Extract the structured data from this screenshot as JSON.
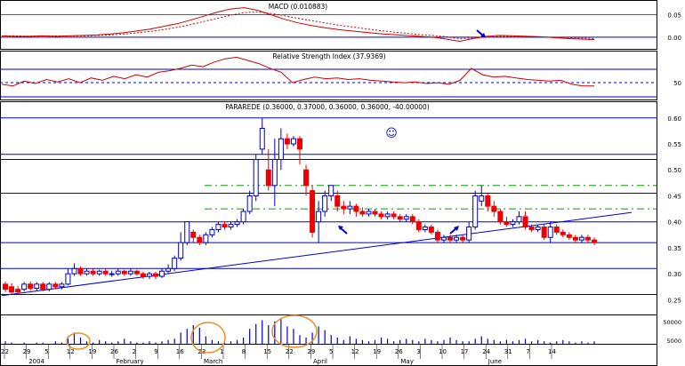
{
  "chart_data": [
    {
      "panel": "macd",
      "type": "line",
      "title": "MACD (0.010883)",
      "series": [
        {
          "values": [
            0.003,
            0.002,
            0.002,
            0.003,
            0.002,
            0.003,
            0.004,
            0.005,
            0.007,
            0.01,
            0.014,
            0.018,
            0.024,
            0.03,
            0.038,
            0.047,
            0.056,
            0.063,
            0.066,
            0.06,
            0.05,
            0.04,
            0.032,
            0.026,
            0.021,
            0.017,
            0.014,
            0.011,
            0.008,
            0.006,
            0.004,
            0.002,
            0.0,
            -0.004,
            -0.009,
            -0.003,
            0.002,
            0.004,
            0.003,
            0.002,
            0.001,
            -0.001,
            -0.003,
            -0.004,
            -0.005
          ]
        },
        {
          "values": [
            0.003,
            0.003,
            0.002,
            0.003,
            0.003,
            0.003,
            0.003,
            0.004,
            0.005,
            0.007,
            0.01,
            0.013,
            0.017,
            0.022,
            0.028,
            0.035,
            0.042,
            0.049,
            0.055,
            0.056,
            0.053,
            0.048,
            0.042,
            0.037,
            0.032,
            0.027,
            0.023,
            0.019,
            0.015,
            0.012,
            0.009,
            0.006,
            0.004,
            0.001,
            -0.003,
            -0.002,
            0.0,
            0.002,
            0.002,
            0.002,
            0.001,
            0.0,
            -0.001,
            -0.002,
            -0.003
          ]
        }
      ],
      "y_ticks": [
        "0.05",
        "0.00"
      ],
      "ylim": [
        -0.012,
        0.075
      ]
    },
    {
      "panel": "rsi",
      "type": "line",
      "title": "Relative Strength Index (37.9369)",
      "series": [
        {
          "values": [
            40,
            38,
            44,
            41,
            46,
            43,
            47,
            42,
            48,
            45,
            50,
            47,
            52,
            49,
            55,
            57,
            60,
            64,
            62,
            68,
            72,
            74,
            70,
            66,
            60,
            55,
            42,
            46,
            49,
            47,
            48,
            46,
            47,
            45,
            44,
            43,
            42,
            43,
            41,
            42,
            40,
            45,
            60,
            52,
            49,
            50,
            48,
            46,
            45,
            44,
            45,
            40,
            38,
            38
          ]
        }
      ],
      "y_ticks": [
        "50"
      ],
      "ylim": [
        22,
        80
      ]
    },
    {
      "panel": "price",
      "type": "candlestick",
      "title": "PARAREDE (0.36000, 0.37000, 0.36000, 0.36000, -40.00000)",
      "annotation": "☺",
      "y_ticks": [
        "0.60",
        "0.55",
        "0.50",
        "0.45",
        "0.40",
        "0.35",
        "0.30",
        "0.25"
      ],
      "ylim": [
        0.225,
        0.615
      ],
      "horizontal_lines": [
        0.6,
        0.53,
        0.52,
        0.455,
        0.4,
        0.36,
        0.31,
        0.26
      ],
      "dashed_lines": [
        0.47,
        0.425
      ],
      "trendline": [
        [
          0,
          0.258
        ],
        [
          96,
          0.418
        ]
      ],
      "candles": [
        {
          "o": 0.28,
          "c": 0.27,
          "h": 0.285,
          "l": 0.265,
          "d": "down"
        },
        {
          "o": 0.275,
          "c": 0.265,
          "h": 0.282,
          "l": 0.26,
          "d": "down"
        },
        {
          "o": 0.27,
          "c": 0.265,
          "h": 0.276,
          "l": 0.26,
          "d": "down"
        },
        {
          "o": 0.27,
          "c": 0.28,
          "h": 0.284,
          "l": 0.266,
          "d": "up"
        },
        {
          "o": 0.28,
          "c": 0.272,
          "h": 0.285,
          "l": 0.268,
          "d": "down"
        },
        {
          "o": 0.272,
          "c": 0.28,
          "h": 0.284,
          "l": 0.268,
          "d": "up"
        },
        {
          "o": 0.28,
          "c": 0.27,
          "h": 0.284,
          "l": 0.266,
          "d": "down"
        },
        {
          "o": 0.27,
          "c": 0.28,
          "h": 0.284,
          "l": 0.266,
          "d": "up"
        },
        {
          "o": 0.28,
          "c": 0.275,
          "h": 0.284,
          "l": 0.27,
          "d": "down"
        },
        {
          "o": 0.275,
          "c": 0.28,
          "h": 0.284,
          "l": 0.27,
          "d": "up"
        },
        {
          "o": 0.28,
          "c": 0.3,
          "h": 0.31,
          "l": 0.278,
          "d": "up"
        },
        {
          "o": 0.3,
          "c": 0.31,
          "h": 0.32,
          "l": 0.296,
          "d": "up"
        },
        {
          "o": 0.31,
          "c": 0.3,
          "h": 0.314,
          "l": 0.296,
          "d": "down"
        },
        {
          "o": 0.3,
          "c": 0.305,
          "h": 0.31,
          "l": 0.296,
          "d": "up"
        },
        {
          "o": 0.305,
          "c": 0.3,
          "h": 0.31,
          "l": 0.296,
          "d": "down"
        },
        {
          "o": 0.3,
          "c": 0.305,
          "h": 0.308,
          "l": 0.296,
          "d": "up"
        },
        {
          "o": 0.305,
          "c": 0.3,
          "h": 0.31,
          "l": 0.296,
          "d": "down"
        },
        {
          "o": 0.3,
          "c": 0.3,
          "h": 0.306,
          "l": 0.294,
          "d": "up"
        },
        {
          "o": 0.3,
          "c": 0.305,
          "h": 0.31,
          "l": 0.296,
          "d": "up"
        },
        {
          "o": 0.305,
          "c": 0.3,
          "h": 0.308,
          "l": 0.296,
          "d": "down"
        },
        {
          "o": 0.3,
          "c": 0.305,
          "h": 0.31,
          "l": 0.296,
          "d": "up"
        },
        {
          "o": 0.305,
          "c": 0.3,
          "h": 0.308,
          "l": 0.296,
          "d": "down"
        },
        {
          "o": 0.3,
          "c": 0.295,
          "h": 0.304,
          "l": 0.29,
          "d": "down"
        },
        {
          "o": 0.295,
          "c": 0.3,
          "h": 0.304,
          "l": 0.29,
          "d": "up"
        },
        {
          "o": 0.3,
          "c": 0.295,
          "h": 0.304,
          "l": 0.29,
          "d": "down"
        },
        {
          "o": 0.295,
          "c": 0.305,
          "h": 0.31,
          "l": 0.292,
          "d": "up"
        },
        {
          "o": 0.305,
          "c": 0.31,
          "h": 0.318,
          "l": 0.3,
          "d": "up"
        },
        {
          "o": 0.31,
          "c": 0.33,
          "h": 0.335,
          "l": 0.305,
          "d": "up"
        },
        {
          "o": 0.33,
          "c": 0.36,
          "h": 0.38,
          "l": 0.325,
          "d": "up"
        },
        {
          "o": 0.36,
          "c": 0.4,
          "h": 0.4,
          "l": 0.355,
          "d": "up"
        },
        {
          "o": 0.38,
          "c": 0.37,
          "h": 0.385,
          "l": 0.36,
          "d": "down"
        },
        {
          "o": 0.37,
          "c": 0.36,
          "h": 0.375,
          "l": 0.355,
          "d": "down"
        },
        {
          "o": 0.36,
          "c": 0.375,
          "h": 0.38,
          "l": 0.355,
          "d": "up"
        },
        {
          "o": 0.375,
          "c": 0.385,
          "h": 0.39,
          "l": 0.37,
          "d": "up"
        },
        {
          "o": 0.385,
          "c": 0.395,
          "h": 0.4,
          "l": 0.38,
          "d": "up"
        },
        {
          "o": 0.395,
          "c": 0.39,
          "h": 0.4,
          "l": 0.385,
          "d": "down"
        },
        {
          "o": 0.39,
          "c": 0.395,
          "h": 0.4,
          "l": 0.385,
          "d": "up"
        },
        {
          "o": 0.395,
          "c": 0.4,
          "h": 0.405,
          "l": 0.39,
          "d": "up"
        },
        {
          "o": 0.4,
          "c": 0.42,
          "h": 0.425,
          "l": 0.395,
          "d": "up"
        },
        {
          "o": 0.42,
          "c": 0.45,
          "h": 0.46,
          "l": 0.415,
          "d": "up"
        },
        {
          "o": 0.45,
          "c": 0.52,
          "h": 0.53,
          "l": 0.44,
          "d": "up"
        },
        {
          "o": 0.54,
          "c": 0.58,
          "h": 0.6,
          "l": 0.53,
          "d": "up"
        },
        {
          "o": 0.5,
          "c": 0.47,
          "h": 0.54,
          "l": 0.46,
          "d": "down"
        },
        {
          "o": 0.47,
          "c": 0.52,
          "h": 0.56,
          "l": 0.43,
          "d": "up"
        },
        {
          "o": 0.52,
          "c": 0.56,
          "h": 0.58,
          "l": 0.5,
          "d": "up"
        },
        {
          "o": 0.56,
          "c": 0.55,
          "h": 0.57,
          "l": 0.54,
          "d": "down"
        },
        {
          "o": 0.55,
          "c": 0.56,
          "h": 0.565,
          "l": 0.545,
          "d": "up"
        },
        {
          "o": 0.56,
          "c": 0.54,
          "h": 0.565,
          "l": 0.51,
          "d": "down"
        },
        {
          "o": 0.5,
          "c": 0.47,
          "h": 0.51,
          "l": 0.45,
          "d": "down"
        },
        {
          "o": 0.46,
          "c": 0.38,
          "h": 0.47,
          "l": 0.37,
          "d": "down"
        },
        {
          "o": 0.4,
          "c": 0.42,
          "h": 0.44,
          "l": 0.36,
          "d": "up"
        },
        {
          "o": 0.42,
          "c": 0.45,
          "h": 0.46,
          "l": 0.41,
          "d": "up"
        },
        {
          "o": 0.45,
          "c": 0.47,
          "h": 0.47,
          "l": 0.44,
          "d": "up"
        },
        {
          "o": 0.45,
          "c": 0.43,
          "h": 0.46,
          "l": 0.42,
          "d": "down"
        },
        {
          "o": 0.43,
          "c": 0.425,
          "h": 0.44,
          "l": 0.415,
          "d": "down"
        },
        {
          "o": 0.425,
          "c": 0.43,
          "h": 0.44,
          "l": 0.415,
          "d": "up"
        },
        {
          "o": 0.43,
          "c": 0.42,
          "h": 0.435,
          "l": 0.41,
          "d": "down"
        },
        {
          "o": 0.42,
          "c": 0.415,
          "h": 0.428,
          "l": 0.41,
          "d": "down"
        },
        {
          "o": 0.415,
          "c": 0.42,
          "h": 0.425,
          "l": 0.41,
          "d": "up"
        },
        {
          "o": 0.42,
          "c": 0.415,
          "h": 0.425,
          "l": 0.41,
          "d": "down"
        },
        {
          "o": 0.415,
          "c": 0.41,
          "h": 0.42,
          "l": 0.405,
          "d": "down"
        },
        {
          "o": 0.41,
          "c": 0.415,
          "h": 0.42,
          "l": 0.405,
          "d": "up"
        },
        {
          "o": 0.415,
          "c": 0.41,
          "h": 0.42,
          "l": 0.405,
          "d": "down"
        },
        {
          "o": 0.41,
          "c": 0.405,
          "h": 0.415,
          "l": 0.4,
          "d": "down"
        },
        {
          "o": 0.405,
          "c": 0.41,
          "h": 0.415,
          "l": 0.4,
          "d": "up"
        },
        {
          "o": 0.41,
          "c": 0.4,
          "h": 0.415,
          "l": 0.395,
          "d": "down"
        },
        {
          "o": 0.4,
          "c": 0.385,
          "h": 0.405,
          "l": 0.38,
          "d": "down"
        },
        {
          "o": 0.385,
          "c": 0.39,
          "h": 0.395,
          "l": 0.38,
          "d": "up"
        },
        {
          "o": 0.39,
          "c": 0.38,
          "h": 0.395,
          "l": 0.375,
          "d": "down"
        },
        {
          "o": 0.38,
          "c": 0.365,
          "h": 0.385,
          "l": 0.36,
          "d": "down"
        },
        {
          "o": 0.365,
          "c": 0.37,
          "h": 0.375,
          "l": 0.36,
          "d": "up"
        },
        {
          "o": 0.37,
          "c": 0.365,
          "h": 0.375,
          "l": 0.36,
          "d": "down"
        },
        {
          "o": 0.365,
          "c": 0.37,
          "h": 0.375,
          "l": 0.36,
          "d": "up"
        },
        {
          "o": 0.37,
          "c": 0.365,
          "h": 0.375,
          "l": 0.36,
          "d": "down"
        },
        {
          "o": 0.365,
          "c": 0.39,
          "h": 0.4,
          "l": 0.36,
          "d": "up"
        },
        {
          "o": 0.39,
          "c": 0.45,
          "h": 0.46,
          "l": 0.385,
          "d": "up"
        },
        {
          "o": 0.44,
          "c": 0.45,
          "h": 0.47,
          "l": 0.43,
          "d": "up"
        },
        {
          "o": 0.45,
          "c": 0.43,
          "h": 0.455,
          "l": 0.42,
          "d": "down"
        },
        {
          "o": 0.43,
          "c": 0.42,
          "h": 0.44,
          "l": 0.41,
          "d": "down"
        },
        {
          "o": 0.42,
          "c": 0.4,
          "h": 0.425,
          "l": 0.395,
          "d": "down"
        },
        {
          "o": 0.4,
          "c": 0.395,
          "h": 0.41,
          "l": 0.39,
          "d": "down"
        },
        {
          "o": 0.395,
          "c": 0.4,
          "h": 0.405,
          "l": 0.39,
          "d": "up"
        },
        {
          "o": 0.4,
          "c": 0.41,
          "h": 0.42,
          "l": 0.395,
          "d": "up"
        },
        {
          "o": 0.41,
          "c": 0.39,
          "h": 0.42,
          "l": 0.385,
          "d": "down"
        },
        {
          "o": 0.39,
          "c": 0.385,
          "h": 0.395,
          "l": 0.38,
          "d": "down"
        },
        {
          "o": 0.385,
          "c": 0.39,
          "h": 0.395,
          "l": 0.38,
          "d": "up"
        },
        {
          "o": 0.39,
          "c": 0.37,
          "h": 0.395,
          "l": 0.365,
          "d": "down"
        },
        {
          "o": 0.37,
          "c": 0.39,
          "h": 0.4,
          "l": 0.36,
          "d": "up"
        },
        {
          "o": 0.39,
          "c": 0.38,
          "h": 0.395,
          "l": 0.375,
          "d": "down"
        },
        {
          "o": 0.38,
          "c": 0.375,
          "h": 0.385,
          "l": 0.37,
          "d": "down"
        },
        {
          "o": 0.375,
          "c": 0.37,
          "h": 0.38,
          "l": 0.365,
          "d": "down"
        },
        {
          "o": 0.37,
          "c": 0.365,
          "h": 0.375,
          "l": 0.36,
          "d": "down"
        },
        {
          "o": 0.365,
          "c": 0.37,
          "h": 0.375,
          "l": 0.36,
          "d": "up"
        },
        {
          "o": 0.37,
          "c": 0.365,
          "h": 0.375,
          "l": 0.36,
          "d": "down"
        },
        {
          "o": 0.365,
          "c": 0.36,
          "h": 0.37,
          "l": 0.355,
          "d": "down"
        }
      ]
    },
    {
      "panel": "volume",
      "type": "bar",
      "y_ticks": [
        "50000",
        "5000"
      ],
      "values": [
        0.2,
        0.1,
        0,
        0.1,
        0,
        0.1,
        0.1,
        0,
        0.2,
        0.1,
        0.6,
        0.9,
        0.5,
        0.2,
        0.1,
        0.3,
        0.2,
        0.1,
        0.2,
        0.4,
        0.2,
        0.1,
        0.1,
        0.2,
        0.1,
        0.2,
        0.3,
        0.4,
        0.9,
        1.2,
        1.5,
        1.3,
        0.6,
        0.3,
        0.2,
        0.1,
        0.2,
        0.3,
        0.5,
        1.2,
        1.6,
        1.9,
        1.5,
        1.8,
        2.0,
        1.4,
        1.2,
        0.7,
        0.5,
        0.9,
        1.4,
        1.1,
        0.7,
        0.5,
        0.3,
        0.6,
        0.4,
        0.3,
        0.2,
        0.3,
        0.5,
        0.4,
        0.2,
        0.3,
        0.4,
        0.3,
        0.2,
        0.4,
        0.3,
        0.2,
        0.3,
        0.5,
        0.3,
        0.2,
        0.2,
        0.4,
        0.6,
        0.4,
        0.3,
        0.2,
        0.3,
        0.2,
        0.3,
        0.4,
        0.2,
        0.3,
        0.2,
        0.1,
        0.2,
        0.3,
        0.2,
        0.1,
        0.2,
        0.1,
        0.2
      ]
    },
    {
      "panel": "x_axis",
      "days": [
        "22",
        "29",
        "5",
        "12",
        "19",
        "26",
        "2",
        "9",
        "16",
        "23",
        "1",
        "8",
        "15",
        "22",
        "29",
        "5",
        "12",
        "19",
        "26",
        "3",
        "10",
        "17",
        "24",
        "31",
        "7",
        "14"
      ],
      "months": [
        "2004",
        "February",
        "March",
        "April",
        "May",
        "June"
      ]
    }
  ]
}
